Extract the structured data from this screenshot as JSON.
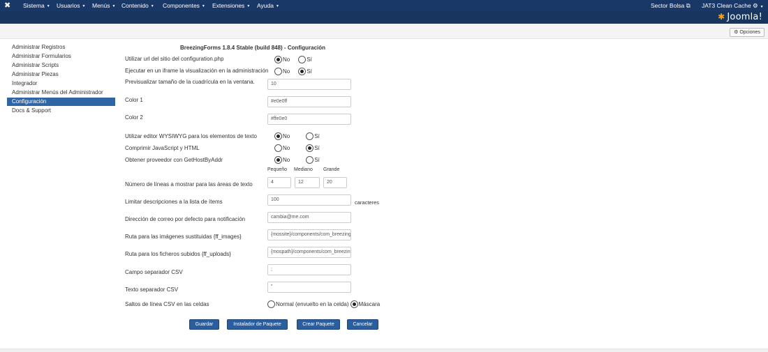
{
  "topnav": {
    "menu": [
      {
        "label": "Sistema"
      },
      {
        "label": "Usuarios"
      },
      {
        "label": "Menús"
      },
      {
        "label": "Contenido"
      },
      {
        "label": "Componentes"
      },
      {
        "label": "Extensiones"
      },
      {
        "label": "Ayuda"
      }
    ],
    "right": {
      "site": "Sector Bolsa",
      "cache": "JAT3 Clean Cache"
    }
  },
  "header": {
    "brand": "Joomla!"
  },
  "toolbar": {
    "options_label": "Opciones"
  },
  "sidebar": {
    "items": [
      {
        "label": "Administrar Registros"
      },
      {
        "label": "Administrar Formularios"
      },
      {
        "label": "Administrar Scripts"
      },
      {
        "label": "Administrar Piezas"
      },
      {
        "label": "Integrador"
      },
      {
        "label": "Administrar Menús del Administrador"
      },
      {
        "label": "Configuración",
        "active": true
      },
      {
        "label": "Docs & Support"
      }
    ]
  },
  "main": {
    "title": "BreezingForms 1.8.4 Stable (build 848) - Configuración",
    "radio_no": "No",
    "radio_si": "Sí",
    "settings": {
      "use_site_url": "Utilizar url del sitio del configuration.php",
      "iframe": "Ejecutar en un iframe la visualización en la administración",
      "grid_preview": "Previsualizar tamaño de la cuadrícula en la ventana.",
      "grid_value": "10",
      "color1": "Color 1",
      "color1_value": "#e0e0ff",
      "color2": "Color 2",
      "color2_value": "#ffe0e0",
      "wysiwyg": "Utilizar editor WYSIWYG para los elementos de texto",
      "compress": "Comprimir JavaScript y HTML",
      "hostbyaddr": "Obtener proveedor con GetHostByAddr",
      "col_small": "Pequeño",
      "col_medium": "Mediano",
      "col_large": "Grande",
      "lines": "Número de líneas a mostrar para las áreas de texto",
      "lines_small": "4",
      "lines_medium": "12",
      "lines_large": "20",
      "limit_desc": "Limitar descripciones a la lista de ítems",
      "limit_value": "100",
      "limit_unit": "caracteres",
      "email": "Dirección de correo por defecto para notificación",
      "email_value": "cambia@me.com",
      "images_path": "Ruta para las imágenes sustituidas {ff_images}",
      "images_value": "{mossite}/components/com_breezingforms",
      "uploads_path": "Ruta para los ficheros subidos {ff_uploads}",
      "uploads_value": "{mospath}/components/com_breezingforms",
      "csv_field_sep": "Campo separador CSV",
      "csv_field_sep_value": ";",
      "csv_text_sep": "Texto separador CSV",
      "csv_text_sep_value": "\"",
      "csv_linebreak": "Saltos de línea CSV en las celdas",
      "csv_normal": "Normal (envuelto en la celda)",
      "csv_mask": "Máscara"
    },
    "buttons": {
      "save": "Guardar",
      "installer": "Instalador de Paquete",
      "create": "Crear Paquete",
      "cancel": "Cancelar"
    }
  }
}
